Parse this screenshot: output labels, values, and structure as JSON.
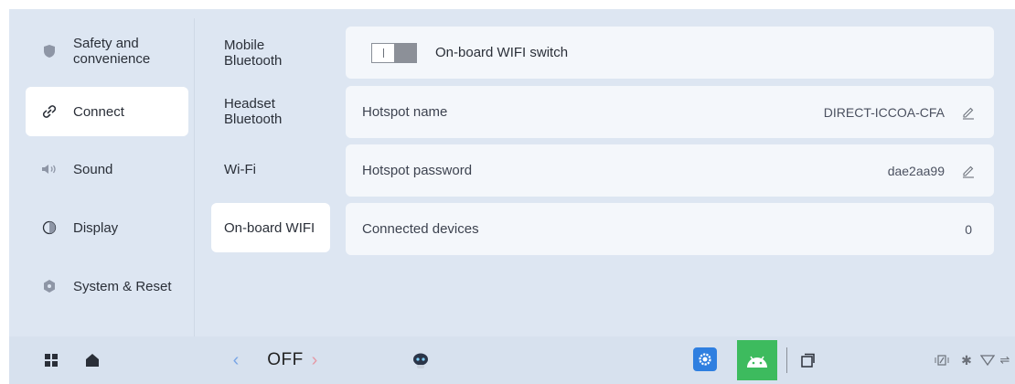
{
  "categories": [
    {
      "label": "Safety and\nconvenience",
      "icon": "shield-icon"
    },
    {
      "label": "Connect",
      "icon": "link-icon",
      "active": true
    },
    {
      "label": "Sound",
      "icon": "speaker-icon"
    },
    {
      "label": "Display",
      "icon": "display-icon"
    },
    {
      "label": "System & Reset",
      "icon": "system-icon"
    }
  ],
  "subnav": [
    {
      "label": "Mobile\nBluetooth"
    },
    {
      "label": "Headset\nBluetooth"
    },
    {
      "label": "Wi-Fi"
    },
    {
      "label": "On-board WIFI",
      "active": true
    }
  ],
  "settings": {
    "switch_label": "On-board WIFI switch",
    "switch_state": "off",
    "hotspot_name_label": "Hotspot name",
    "hotspot_name_value": "DIRECT-ICCOA-CFA",
    "hotspot_password_label": "Hotspot password",
    "hotspot_password_value": "dae2aa99",
    "connected_devices_label": "Connected devices",
    "connected_devices_value": "0"
  },
  "taskbar": {
    "climate_label": "OFF",
    "icons": [
      "apps-grid-icon",
      "home-icon",
      "chevron-left-icon",
      "chevron-right-icon",
      "robot-assistant-icon",
      "settings-app-icon",
      "android-app-icon",
      "window-switch-icon",
      "phone-signal-icon",
      "bluetooth-icon",
      "wifi-icon",
      "more-icon"
    ]
  },
  "colors": {
    "background": "#dde6f2",
    "card": "#f4f7fb",
    "active_item": "#ffffff",
    "settings_app": "#2f7fe0",
    "android_app": "#3dbb5e"
  }
}
